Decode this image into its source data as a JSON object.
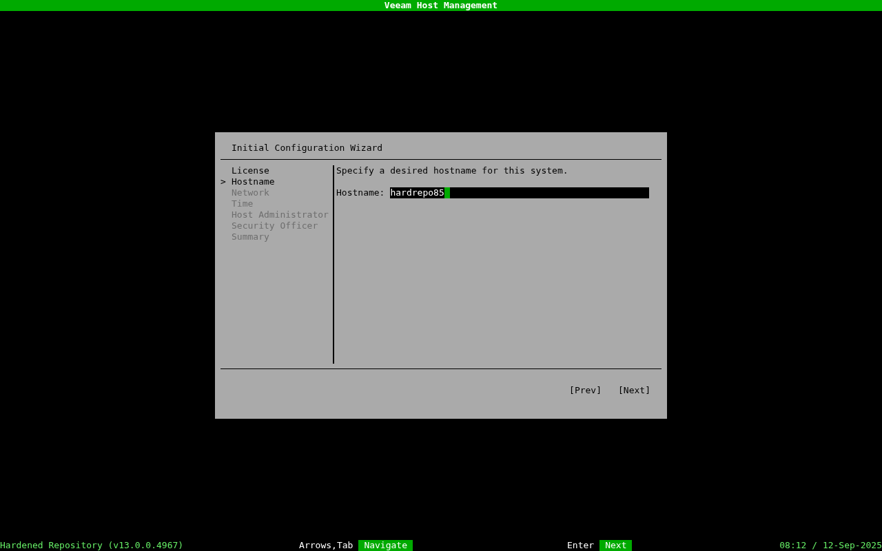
{
  "top_bar": {
    "title": "Veeam Host Management"
  },
  "dialog": {
    "title": "Initial Configuration Wizard",
    "steps": {
      "pointer": ">",
      "items": [
        {
          "label": "License",
          "selected": false,
          "disabled": false
        },
        {
          "label": "Hostname",
          "selected": true,
          "disabled": false
        },
        {
          "label": "Network",
          "selected": false,
          "disabled": true
        },
        {
          "label": "Time",
          "selected": false,
          "disabled": true
        },
        {
          "label": "Host Administrator",
          "selected": false,
          "disabled": true
        },
        {
          "label": "Security Officer",
          "selected": false,
          "disabled": true
        },
        {
          "label": "Summary",
          "selected": false,
          "disabled": true
        }
      ]
    },
    "prompt": "Specify a desired hostname for this system.",
    "field": {
      "label": "Hostname:",
      "value": "hardrepo85"
    },
    "buttons": [
      "[Prev]",
      "[Next]"
    ]
  },
  "status_bar": {
    "product": "Hardened Repository (v13.0.0.4967)",
    "hints": [
      {
        "key": "Arrows,Tab",
        "action": "Navigate"
      },
      {
        "key": "Enter",
        "action": "Next"
      }
    ],
    "clock": "08:12 / 12-Sep-2025"
  }
}
